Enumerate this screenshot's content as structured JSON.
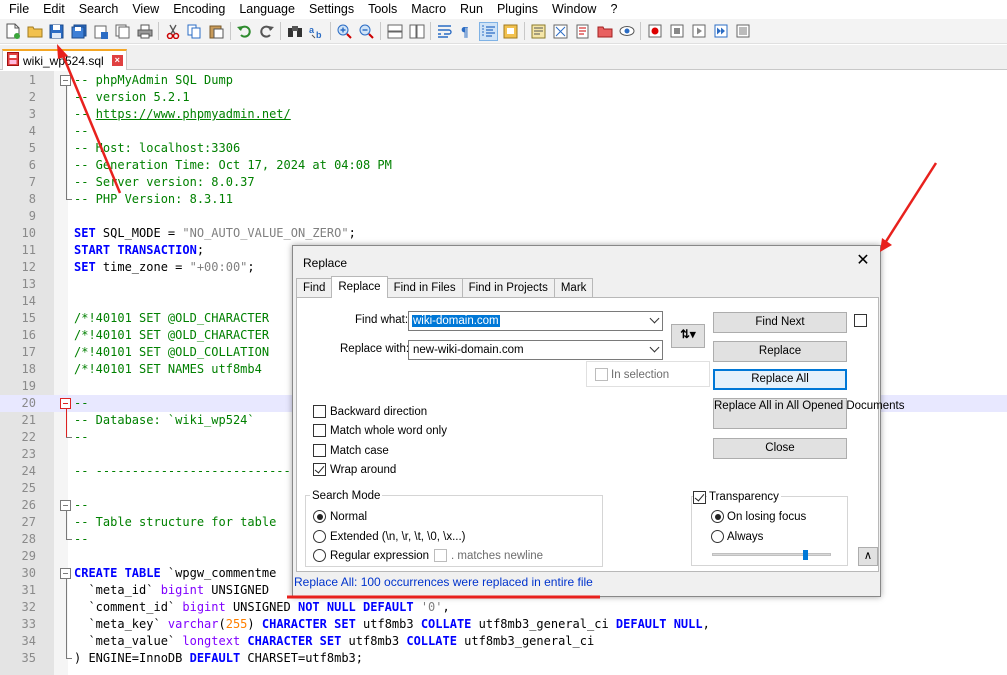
{
  "menu": [
    "File",
    "Edit",
    "Search",
    "View",
    "Encoding",
    "Language",
    "Settings",
    "Tools",
    "Macro",
    "Run",
    "Plugins",
    "Window",
    "?"
  ],
  "toolbar_icons": [
    "new-file-icon",
    "open-file-icon",
    "save-icon",
    "save-all-icon",
    "close-icon",
    "close-all-icon",
    "print-icon",
    "cut-icon",
    "copy-icon",
    "paste-icon",
    "undo-icon",
    "redo-icon",
    "find-icon",
    "replace-icon",
    "zoom-in-icon",
    "zoom-out-icon",
    "sync-vertical-icon",
    "sync-horizontal-icon",
    "word-wrap-icon",
    "show-all-chars-icon",
    "indent-guide-icon",
    "doc-map-icon",
    "function-list-icon",
    "folder-workspace-icon",
    "monitoring-icon",
    "record-macro-icon",
    "stop-record-icon",
    "play-macro-icon",
    "run-macro-multiple-icon",
    "save-macro-icon"
  ],
  "tab": {
    "label": "wiki_wp524.sql"
  },
  "editor": {
    "lines": [
      {
        "n": "1",
        "segs": [
          {
            "c": "cmt",
            "t": "-- phpMyAdmin SQL Dump"
          }
        ]
      },
      {
        "n": "2",
        "segs": [
          {
            "c": "cmt",
            "t": "-- version 5.2.1"
          }
        ]
      },
      {
        "n": "3",
        "segs": [
          {
            "c": "cmt",
            "t": "-- "
          },
          {
            "c": "url",
            "t": "https://www.phpmyadmin.net/"
          }
        ]
      },
      {
        "n": "4",
        "segs": [
          {
            "c": "cmt",
            "t": "--"
          }
        ]
      },
      {
        "n": "5",
        "segs": [
          {
            "c": "cmt",
            "t": "-- Host: localhost:3306"
          }
        ]
      },
      {
        "n": "6",
        "segs": [
          {
            "c": "cmt",
            "t": "-- Generation Time: Oct 17, 2024 at 04:08 PM"
          }
        ]
      },
      {
        "n": "7",
        "segs": [
          {
            "c": "cmt",
            "t": "-- Server version: 8.0.37"
          }
        ]
      },
      {
        "n": "8",
        "segs": [
          {
            "c": "cmt",
            "t": "-- PHP Version: 8.3.11"
          }
        ]
      },
      {
        "n": "9",
        "segs": []
      },
      {
        "n": "10",
        "segs": [
          {
            "c": "kw",
            "t": "SET"
          },
          {
            "c": "def",
            "t": " SQL_MODE = "
          },
          {
            "c": "str",
            "t": "\"NO_AUTO_VALUE_ON_ZERO\""
          },
          {
            "c": "def",
            "t": ";"
          }
        ]
      },
      {
        "n": "11",
        "segs": [
          {
            "c": "kw",
            "t": "START TRANSACTION"
          },
          {
            "c": "def",
            "t": ";"
          }
        ]
      },
      {
        "n": "12",
        "segs": [
          {
            "c": "kw",
            "t": "SET"
          },
          {
            "c": "def",
            "t": " time_zone = "
          },
          {
            "c": "str",
            "t": "\"+00:00\""
          },
          {
            "c": "def",
            "t": ";"
          }
        ]
      },
      {
        "n": "13",
        "segs": []
      },
      {
        "n": "14",
        "segs": []
      },
      {
        "n": "15",
        "segs": [
          {
            "c": "cmt",
            "t": "/*!40101 SET @OLD_CHARACTER"
          }
        ]
      },
      {
        "n": "16",
        "segs": [
          {
            "c": "cmt",
            "t": "/*!40101 SET @OLD_CHARACTER"
          }
        ]
      },
      {
        "n": "17",
        "segs": [
          {
            "c": "cmt",
            "t": "/*!40101 SET @OLD_COLLATION"
          }
        ]
      },
      {
        "n": "18",
        "segs": [
          {
            "c": "cmt",
            "t": "/*!40101 SET NAMES utf8mb4 "
          }
        ]
      },
      {
        "n": "19",
        "segs": []
      },
      {
        "n": "20",
        "segs": [
          {
            "c": "cmt",
            "t": "--"
          }
        ]
      },
      {
        "n": "21",
        "segs": [
          {
            "c": "cmt",
            "t": "-- Database: `wiki_wp524`"
          }
        ]
      },
      {
        "n": "22",
        "segs": [
          {
            "c": "cmt",
            "t": "--"
          }
        ]
      },
      {
        "n": "23",
        "segs": []
      },
      {
        "n": "24",
        "segs": [
          {
            "c": "cmt",
            "t": "-- ---------------------------"
          }
        ]
      },
      {
        "n": "25",
        "segs": []
      },
      {
        "n": "26",
        "segs": [
          {
            "c": "cmt",
            "t": "--"
          }
        ]
      },
      {
        "n": "27",
        "segs": [
          {
            "c": "cmt",
            "t": "-- Table structure for table"
          }
        ]
      },
      {
        "n": "28",
        "segs": [
          {
            "c": "cmt",
            "t": "--"
          }
        ]
      },
      {
        "n": "29",
        "segs": []
      },
      {
        "n": "30",
        "segs": [
          {
            "c": "kw",
            "t": "CREATE TABLE"
          },
          {
            "c": "def",
            "t": " `wpgw_commentme"
          }
        ]
      },
      {
        "n": "31",
        "segs": [
          {
            "c": "def",
            "t": "  `meta_id` "
          },
          {
            "c": "type",
            "t": "bigint"
          },
          {
            "c": "def",
            "t": " UNSIGNED"
          }
        ]
      },
      {
        "n": "32",
        "segs": [
          {
            "c": "def",
            "t": "  `comment_id` "
          },
          {
            "c": "type",
            "t": "bigint"
          },
          {
            "c": "def",
            "t": " UNSIGNED "
          },
          {
            "c": "kw",
            "t": "NOT NULL DEFAULT"
          },
          {
            "c": "def",
            "t": " "
          },
          {
            "c": "str",
            "t": "'0'"
          },
          {
            "c": "def",
            "t": ","
          }
        ]
      },
      {
        "n": "33",
        "segs": [
          {
            "c": "def",
            "t": "  `meta_key` "
          },
          {
            "c": "type",
            "t": "varchar"
          },
          {
            "c": "def",
            "t": "("
          },
          {
            "c": "num",
            "t": "255"
          },
          {
            "c": "def",
            "t": ") "
          },
          {
            "c": "kw",
            "t": "CHARACTER SET"
          },
          {
            "c": "def",
            "t": " utf8mb3 "
          },
          {
            "c": "kw",
            "t": "COLLATE"
          },
          {
            "c": "def",
            "t": " utf8mb3_general_ci "
          },
          {
            "c": "kw",
            "t": "DEFAULT NULL"
          },
          {
            "c": "def",
            "t": ","
          }
        ]
      },
      {
        "n": "34",
        "segs": [
          {
            "c": "def",
            "t": "  `meta_value` "
          },
          {
            "c": "type",
            "t": "longtext"
          },
          {
            "c": "def",
            "t": " "
          },
          {
            "c": "kw",
            "t": "CHARACTER SET"
          },
          {
            "c": "def",
            "t": " utf8mb3 "
          },
          {
            "c": "kw",
            "t": "COLLATE"
          },
          {
            "c": "def",
            "t": " utf8mb3_general_ci"
          }
        ]
      },
      {
        "n": "35",
        "segs": [
          {
            "c": "def",
            "t": ") ENGINE=InnoDB "
          },
          {
            "c": "kw",
            "t": "DEFAULT"
          },
          {
            "c": "def",
            "t": " CHARSET=utf8mb3;"
          }
        ]
      }
    ]
  },
  "dialog": {
    "title": "Replace",
    "tabs": [
      "Find",
      "Replace",
      "Find in Files",
      "Find in Projects",
      "Mark"
    ],
    "find_what_label": "Find what:",
    "find_what_value": "wiki-domain.com",
    "replace_with_label": "Replace with:",
    "replace_with_value": "new-wiki-domain.com",
    "in_selection_label": "In selection",
    "buttons": {
      "find_next": "Find Next",
      "replace": "Replace",
      "replace_all": "Replace All",
      "replace_all_opened": "Replace All in All Opened Documents",
      "close": "Close"
    },
    "options": {
      "backward": "Backward direction",
      "whole_word": "Match whole word only",
      "match_case": "Match case",
      "wrap_around": "Wrap around"
    },
    "search_mode": {
      "title": "Search Mode",
      "normal": "Normal",
      "extended": "Extended (\\n, \\r, \\t, \\0, \\x...)",
      "regex": "Regular expression",
      "matches_newline": ". matches newline"
    },
    "transparency": {
      "title": "Transparency",
      "on_losing_focus": "On losing focus",
      "always": "Always",
      "level": 0.8
    },
    "status": "Replace All: 100 occurrences were replaced in entire file"
  },
  "colors": {
    "annotation_red": "#e8211d",
    "comment_green": "#008000",
    "keyword_blue": "#0000ff",
    "status_blue": "#0033cc"
  }
}
